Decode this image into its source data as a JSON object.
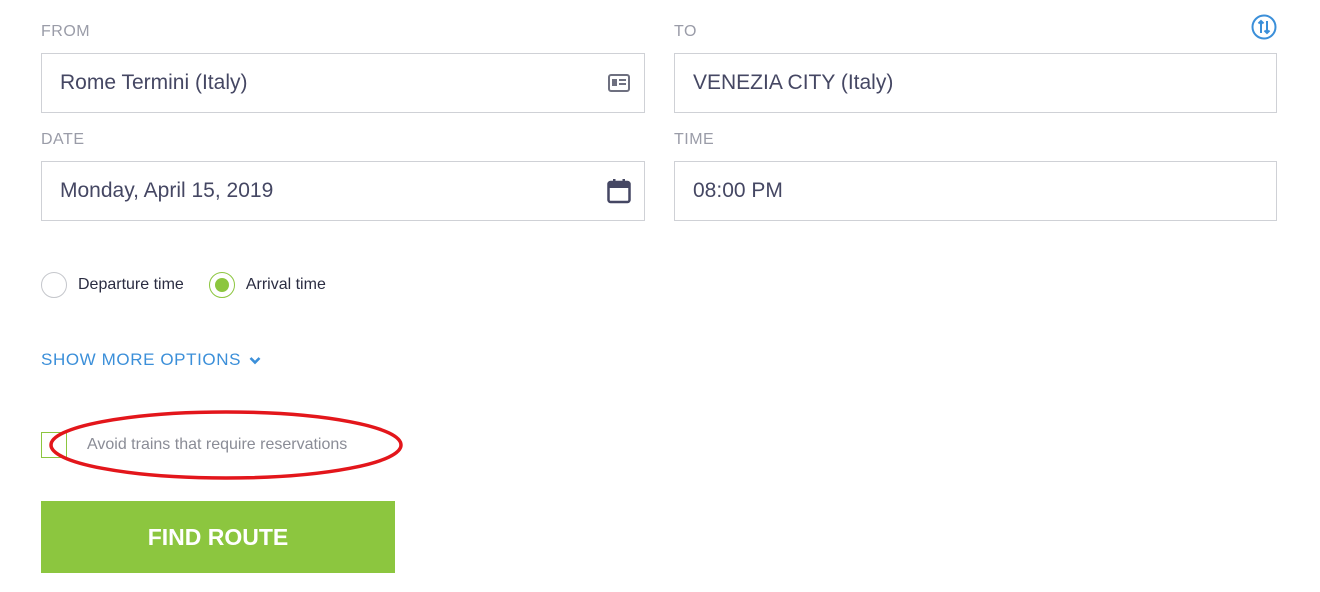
{
  "form": {
    "from": {
      "label": "FROM",
      "value": "Rome Termini (Italy)",
      "icon": "id-card-icon"
    },
    "to": {
      "label": "TO",
      "value": "VENEZIA CITY (Italy)"
    },
    "swap_icon": "swap-icon",
    "date": {
      "label": "DATE",
      "value": "Monday, April 15, 2019",
      "icon": "calendar-icon"
    },
    "time": {
      "label": "TIME",
      "value": "08:00 PM"
    }
  },
  "time_mode": {
    "options": [
      {
        "label": "Departure time",
        "checked": false
      },
      {
        "label": "Arrival time",
        "checked": true
      }
    ]
  },
  "more_options": {
    "label": "SHOW MORE OPTIONS",
    "icon": "chevron-down-icon"
  },
  "reservations_checkbox": {
    "label": "Avoid trains that require reservations",
    "checked": false
  },
  "find_button": {
    "label": "FIND ROUTE"
  },
  "colors": {
    "accent_green": "#8cc63f",
    "link_blue": "#3b8fd9",
    "annotation_red": "#e3161b",
    "input_text": "#454763",
    "label_gray": "#9a9ca8"
  }
}
